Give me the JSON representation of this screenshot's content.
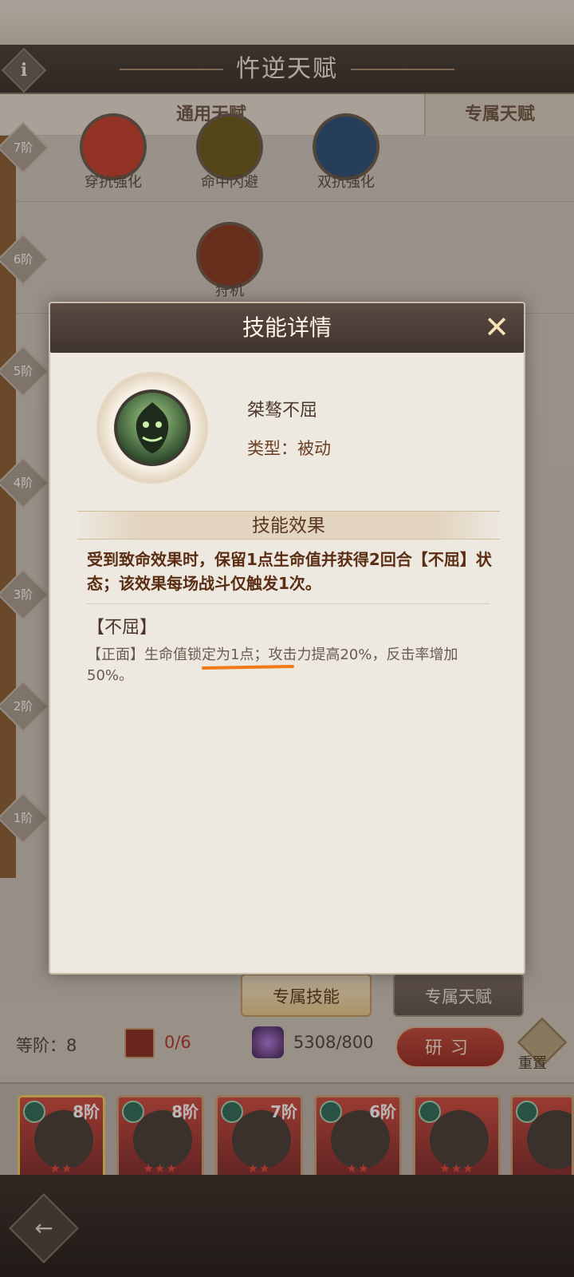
{
  "screen": {
    "title": "忤逆天赋",
    "info_icon": "i",
    "tabs": [
      "通用天赋",
      "专属天赋"
    ]
  },
  "tiers": [
    "7阶",
    "6阶",
    "5阶",
    "4阶",
    "3阶",
    "2阶",
    "1阶"
  ],
  "talent_nodes": {
    "row7": [
      "穿抗强化",
      "命中闪避",
      "双抗强化"
    ],
    "row6": [
      "狩机"
    ]
  },
  "bottom_tabs": {
    "skill": "专属技能",
    "talent": "专属天赋"
  },
  "stats": {
    "level_label": "等阶：8",
    "cards": "0/6",
    "orbs": "5308/800"
  },
  "study_button": "研习",
  "reset_label": "重置",
  "heroes": [
    {
      "tier": "8阶",
      "stars": "★★",
      "selected": true
    },
    {
      "tier": "8阶",
      "stars": "★★★"
    },
    {
      "tier": "7阶",
      "stars": "★★"
    },
    {
      "tier": "6阶",
      "stars": "★★"
    },
    {
      "tier": "",
      "stars": "★★★"
    },
    {
      "tier": "",
      "stars": ""
    }
  ],
  "modal": {
    "title": "技能详情",
    "close_icon": "✕",
    "skill_name": "桀骜不屈",
    "skill_type": "类型：被动",
    "effect_header": "技能效果",
    "effect_text": "受到致命效果时，保留1点生命值并获得2回合【不屈】状态；该效果每场战斗仅触发1次。",
    "status_name": "【不屈】",
    "status_desc": "【正面】生命值锁定为1点；攻击力提高20%，反击率增加50%。"
  },
  "colors": {
    "highlight_underline": "#f07a1a",
    "study_button": "#c24a3b",
    "card_count": "#b2332b"
  }
}
